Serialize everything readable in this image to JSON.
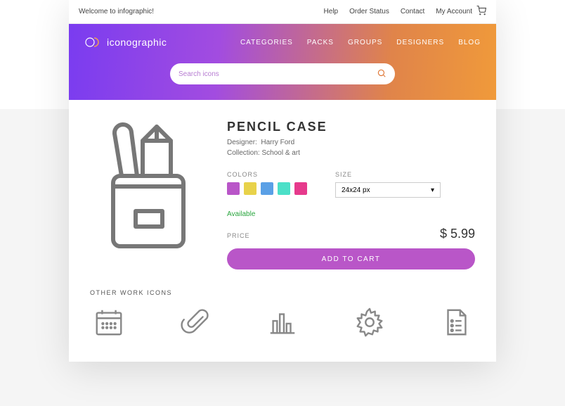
{
  "topbar": {
    "welcome": "Welcome to infographic!",
    "links": {
      "help": "Help",
      "order": "Order Status",
      "contact": "Contact",
      "account": "My Account"
    }
  },
  "brand": "iconographic",
  "nav": {
    "categories": "CATEGORIES",
    "packs": "PACKS",
    "groups": "GROUPS",
    "designers": "DESIGNERS",
    "blog": "BLOG"
  },
  "search": {
    "placeholder": "Search icons"
  },
  "product": {
    "title": "PENCIL CASE",
    "designer_label": "Designer:",
    "designer": "Harry Ford",
    "collection_label": "Collection:",
    "collection": "School & art",
    "colors_label": "COLORS",
    "swatches": [
      "#b956c8",
      "#e8d24a",
      "#5aa0e6",
      "#4ce0c8",
      "#e63a8c"
    ],
    "size_label": "SIZE",
    "size_value": "24x24 px",
    "availability": "Available",
    "price_label": "PRICE",
    "price": "$ 5.99",
    "add_label": "ADD TO CART"
  },
  "other": {
    "label": "OTHER WORK ICONS"
  }
}
